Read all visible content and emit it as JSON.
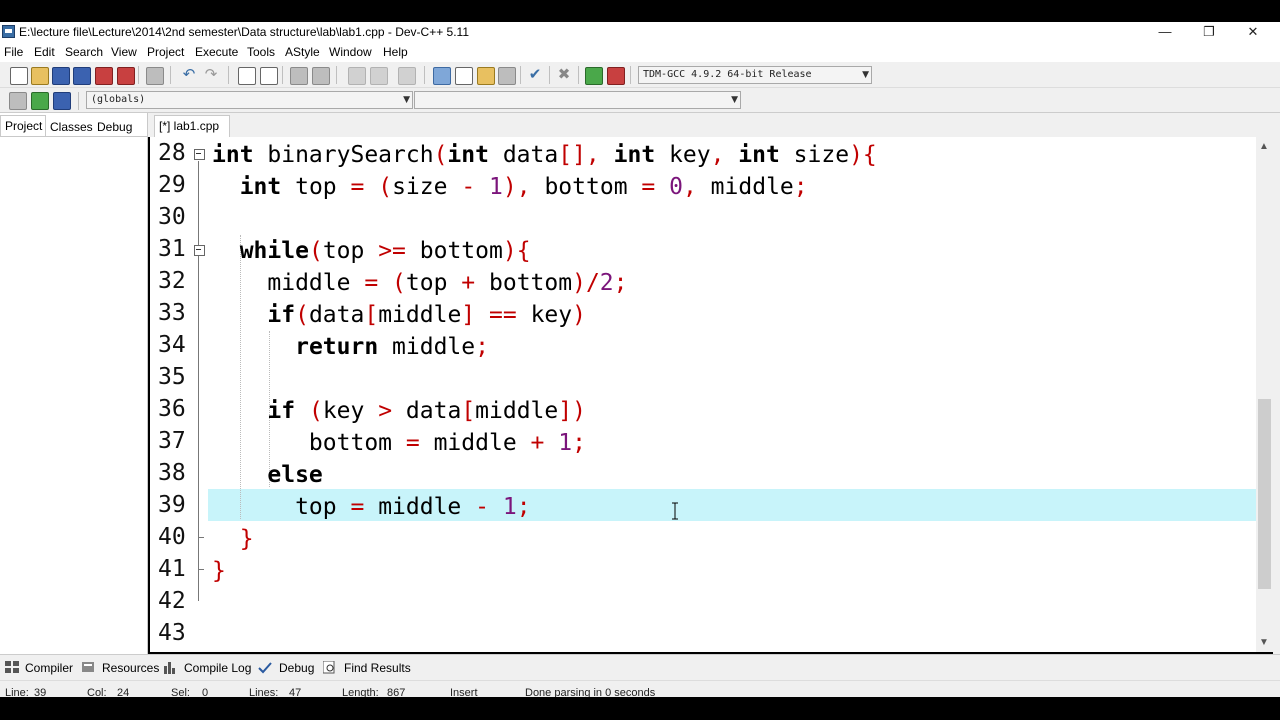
{
  "window": {
    "title": "E:\\lecture file\\Lecture\\2014\\2nd semester\\Data structure\\lab\\lab1.cpp - Dev-C++ 5.11",
    "controls": {
      "minimize": "—",
      "restore": "❐",
      "close": "✕"
    }
  },
  "menu": [
    "File",
    "Edit",
    "Search",
    "View",
    "Project",
    "Execute",
    "Tools",
    "AStyle",
    "Window",
    "Help"
  ],
  "toolbar": {
    "compiler_select": "TDM-GCC 4.9.2 64-bit Release",
    "scope_select": "(globals)",
    "member_select": ""
  },
  "left_panel": {
    "tabs": [
      "Project",
      "Classes",
      "Debug"
    ],
    "active_tab": "Project"
  },
  "editor": {
    "file_tab": "[*] lab1.cpp",
    "current_line": 39,
    "lines": [
      {
        "n": "28",
        "tokens": [
          [
            "int",
            "kw"
          ],
          [
            " binarySearch",
            "id"
          ],
          [
            "(",
            "sy"
          ],
          [
            "int",
            "kw"
          ],
          [
            " data",
            "id"
          ],
          [
            "[],",
            "sy"
          ],
          [
            " ",
            "id"
          ],
          [
            "int",
            "kw"
          ],
          [
            " key",
            "id"
          ],
          [
            ",",
            "sy"
          ],
          [
            " ",
            "id"
          ],
          [
            "int",
            "kw"
          ],
          [
            " size",
            "id"
          ],
          [
            "){",
            "sy"
          ]
        ]
      },
      {
        "n": "29",
        "tokens": [
          [
            "  ",
            "id"
          ],
          [
            "int",
            "kw"
          ],
          [
            " top ",
            "id"
          ],
          [
            "=",
            "sy"
          ],
          [
            " ",
            "id"
          ],
          [
            "(",
            "sy"
          ],
          [
            "size ",
            "id"
          ],
          [
            "-",
            "sy"
          ],
          [
            " ",
            "id"
          ],
          [
            "1",
            "nu"
          ],
          [
            "),",
            "sy"
          ],
          [
            " bottom ",
            "id"
          ],
          [
            "=",
            "sy"
          ],
          [
            " ",
            "id"
          ],
          [
            "0",
            "nu"
          ],
          [
            ",",
            "sy"
          ],
          [
            " middle",
            "id"
          ],
          [
            ";",
            "sy"
          ]
        ]
      },
      {
        "n": "30",
        "tokens": []
      },
      {
        "n": "31",
        "tokens": [
          [
            "  ",
            "id"
          ],
          [
            "while",
            "kw"
          ],
          [
            "(",
            "sy"
          ],
          [
            "top ",
            "id"
          ],
          [
            ">=",
            "sy"
          ],
          [
            " bottom",
            "id"
          ],
          [
            "){",
            "sy"
          ]
        ]
      },
      {
        "n": "32",
        "tokens": [
          [
            "    middle ",
            "id"
          ],
          [
            "=",
            "sy"
          ],
          [
            " ",
            "id"
          ],
          [
            "(",
            "sy"
          ],
          [
            "top ",
            "id"
          ],
          [
            "+",
            "sy"
          ],
          [
            " bottom",
            "id"
          ],
          [
            ")/",
            "sy"
          ],
          [
            "2",
            "nu"
          ],
          [
            ";",
            "sy"
          ]
        ]
      },
      {
        "n": "33",
        "tokens": [
          [
            "    ",
            "id"
          ],
          [
            "if",
            "kw"
          ],
          [
            "(",
            "sy"
          ],
          [
            "data",
            "id"
          ],
          [
            "[",
            "sy"
          ],
          [
            "middle",
            "id"
          ],
          [
            "]",
            "sy"
          ],
          [
            " ",
            "id"
          ],
          [
            "==",
            "sy"
          ],
          [
            " key",
            "id"
          ],
          [
            ")",
            "sy"
          ]
        ]
      },
      {
        "n": "34",
        "tokens": [
          [
            "      ",
            "id"
          ],
          [
            "return",
            "kw"
          ],
          [
            " middle",
            "id"
          ],
          [
            ";",
            "sy"
          ]
        ]
      },
      {
        "n": "35",
        "tokens": []
      },
      {
        "n": "36",
        "tokens": [
          [
            "    ",
            "id"
          ],
          [
            "if",
            "kw"
          ],
          [
            " ",
            "id"
          ],
          [
            "(",
            "sy"
          ],
          [
            "key ",
            "id"
          ],
          [
            ">",
            "sy"
          ],
          [
            " data",
            "id"
          ],
          [
            "[",
            "sy"
          ],
          [
            "middle",
            "id"
          ],
          [
            "])",
            "sy"
          ]
        ]
      },
      {
        "n": "37",
        "tokens": [
          [
            "       bottom ",
            "id"
          ],
          [
            "=",
            "sy"
          ],
          [
            " middle ",
            "id"
          ],
          [
            "+",
            "sy"
          ],
          [
            " ",
            "id"
          ],
          [
            "1",
            "nu"
          ],
          [
            ";",
            "sy"
          ]
        ]
      },
      {
        "n": "38",
        "tokens": [
          [
            "    ",
            "id"
          ],
          [
            "else",
            "kw"
          ]
        ]
      },
      {
        "n": "39",
        "tokens": [
          [
            "      top ",
            "id"
          ],
          [
            "=",
            "sy"
          ],
          [
            " middle ",
            "id"
          ],
          [
            "-",
            "sy"
          ],
          [
            " ",
            "id"
          ],
          [
            "1",
            "nu"
          ],
          [
            ";",
            "sy"
          ]
        ]
      },
      {
        "n": "40",
        "tokens": [
          [
            "  ",
            "id"
          ],
          [
            "}",
            "sy"
          ]
        ]
      },
      {
        "n": "41",
        "tokens": [
          [
            "}",
            "sy"
          ]
        ]
      },
      {
        "n": "42",
        "tokens": []
      },
      {
        "n": "43",
        "tokens": []
      }
    ]
  },
  "bottom_tabs": [
    "Compiler",
    "Resources",
    "Compile Log",
    "Debug",
    "Find Results"
  ],
  "status": {
    "line_label": "Line:",
    "line_value": "39",
    "col_label": "Col:",
    "col_value": "24",
    "sel_label": "Sel:",
    "sel_value": "0",
    "lines_label": "Lines:",
    "lines_value": "47",
    "length_label": "Length:",
    "length_value": "867",
    "mode": "Insert",
    "message": "Done parsing in 0 seconds"
  },
  "colors": {
    "keyword": "#000000",
    "symbol": "#c00000",
    "number": "#7b157b",
    "current_line": "#c8f4fa"
  }
}
